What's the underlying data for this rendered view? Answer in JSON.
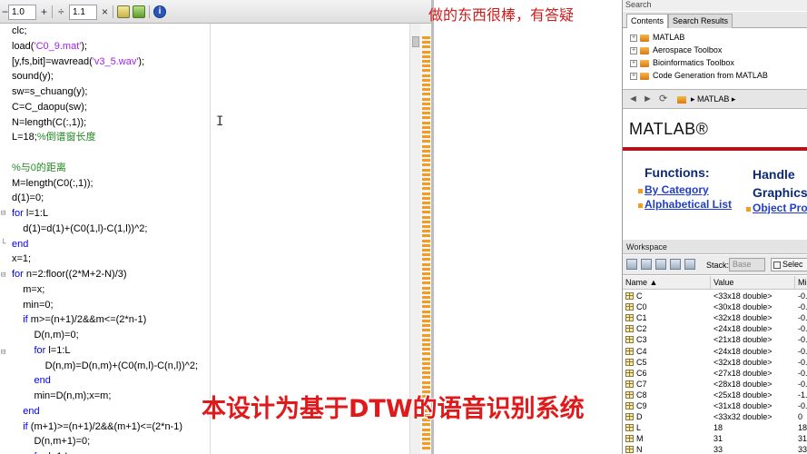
{
  "toolbar": {
    "field_left": "1.0",
    "field_right": "1.1",
    "glyph_minus": "−",
    "glyph_plus": "+",
    "glyph_divide": "÷",
    "glyph_close": "×",
    "info_glyph": "i"
  },
  "editor": {
    "lines": [
      {
        "parts": [
          {
            "t": "clc;",
            "c": "plain"
          }
        ]
      },
      {
        "parts": [
          {
            "t": "load(",
            "c": "plain"
          },
          {
            "t": "'C0_9.mat'",
            "c": "str"
          },
          {
            "t": ");",
            "c": "plain"
          }
        ]
      },
      {
        "parts": [
          {
            "t": "[y,fs,bit]=wavread(",
            "c": "plain"
          },
          {
            "t": "'v3_5.wav'",
            "c": "str"
          },
          {
            "t": ");",
            "c": "plain"
          }
        ]
      },
      {
        "parts": [
          {
            "t": "sound(y);",
            "c": "plain"
          }
        ]
      },
      {
        "parts": [
          {
            "t": "sw=s_chuang(y);",
            "c": "plain"
          }
        ]
      },
      {
        "parts": [
          {
            "t": "C=C_daopu(sw);",
            "c": "plain"
          }
        ]
      },
      {
        "parts": [
          {
            "t": "N=length(C(:,1));",
            "c": "plain"
          }
        ]
      },
      {
        "parts": [
          {
            "t": "L=18;",
            "c": "plain"
          },
          {
            "t": "%倒谱窗长度",
            "c": "cmt"
          }
        ]
      },
      {
        "parts": [
          {
            "t": "",
            "c": "plain"
          }
        ]
      },
      {
        "parts": [
          {
            "t": "%与0的距离",
            "c": "cmt"
          }
        ]
      },
      {
        "parts": [
          {
            "t": "M=length(C0(:,1));",
            "c": "plain"
          }
        ]
      },
      {
        "parts": [
          {
            "t": "d(1)=0;",
            "c": "plain"
          }
        ]
      },
      {
        "parts": [
          {
            "t": "for",
            "c": "kw"
          },
          {
            "t": " l=1:L",
            "c": "plain"
          }
        ]
      },
      {
        "parts": [
          {
            "t": "    d(1)=d(1)+(C0(1,l)-C(1,l))^2;",
            "c": "plain"
          }
        ]
      },
      {
        "parts": [
          {
            "t": "end",
            "c": "kw"
          }
        ]
      },
      {
        "parts": [
          {
            "t": "x=1;",
            "c": "plain"
          }
        ]
      },
      {
        "parts": [
          {
            "t": "for",
            "c": "kw"
          },
          {
            "t": " n=2:floor((2*M+2-N)/3)",
            "c": "plain"
          }
        ]
      },
      {
        "parts": [
          {
            "t": "    m=x;",
            "c": "plain"
          }
        ]
      },
      {
        "parts": [
          {
            "t": "    min=0;",
            "c": "plain"
          }
        ]
      },
      {
        "parts": [
          {
            "t": "    ",
            "c": "plain"
          },
          {
            "t": "if",
            "c": "kw"
          },
          {
            "t": " m>=(n+1)/2&&m<=(2*n-1)",
            "c": "plain"
          }
        ]
      },
      {
        "parts": [
          {
            "t": "        D(n,m)=0;",
            "c": "plain"
          }
        ]
      },
      {
        "parts": [
          {
            "t": "        ",
            "c": "plain"
          },
          {
            "t": "for",
            "c": "kw"
          },
          {
            "t": " l=1:L",
            "c": "plain"
          }
        ]
      },
      {
        "parts": [
          {
            "t": "            D(n,m)=D(n,m)+(C0(m,l)-C(n,l))^2;",
            "c": "plain"
          }
        ]
      },
      {
        "parts": [
          {
            "t": "        ",
            "c": "plain"
          },
          {
            "t": "end",
            "c": "kw"
          }
        ]
      },
      {
        "parts": [
          {
            "t": "        min=D(n,m);x=m;",
            "c": "plain"
          }
        ]
      },
      {
        "parts": [
          {
            "t": "    ",
            "c": "plain"
          },
          {
            "t": "end",
            "c": "kw"
          }
        ]
      },
      {
        "parts": [
          {
            "t": "    ",
            "c": "plain"
          },
          {
            "t": "if",
            "c": "kw"
          },
          {
            "t": " (m+1)>=(n+1)/2&&(m+1)<=(2*n-1)",
            "c": "plain"
          }
        ]
      },
      {
        "parts": [
          {
            "t": "        D(n,m+1)=0;",
            "c": "plain"
          }
        ]
      },
      {
        "parts": [
          {
            "t": "        ",
            "c": "plain"
          },
          {
            "t": "for",
            "c": "kw"
          },
          {
            "t": " l=1:L",
            "c": "plain"
          }
        ]
      }
    ],
    "caret_glyph": "I"
  },
  "overlay_note": "做的东西很棒，有答疑",
  "help": {
    "search_label": "Search",
    "tabs": [
      "Contents",
      "Search Results"
    ],
    "toc": [
      "MATLAB",
      "Aerospace Toolbox",
      "Bioinformatics Toolbox",
      "Code Generation from MATLAB"
    ],
    "toc_expander": "+",
    "nav_back": "◄",
    "nav_forward": "►",
    "nav_refresh": "⟳",
    "breadcrumb": "▸ MATLAB ▸",
    "logo": "MATLAB®",
    "functions_title": "Functions:",
    "functions_links": [
      "By Category",
      "Alphabetical List"
    ],
    "handle_title": "Handle Graphics",
    "handle_link": "Object Pro",
    "brand_color": "#b7131a"
  },
  "workspace": {
    "title": "Workspace",
    "stack_label": "Stack:",
    "stack_value": "Base",
    "select_label": "Selec",
    "columns": [
      "Name ▲",
      "Value",
      "Mi"
    ],
    "rows": [
      {
        "name": "C",
        "value": "<33x18 double>",
        "min": "-0."
      },
      {
        "name": "C0",
        "value": "<30x18 double>",
        "min": "-0."
      },
      {
        "name": "C1",
        "value": "<32x18 double>",
        "min": "-0."
      },
      {
        "name": "C2",
        "value": "<24x18 double>",
        "min": "-0."
      },
      {
        "name": "C3",
        "value": "<21x18 double>",
        "min": "-0."
      },
      {
        "name": "C4",
        "value": "<24x18 double>",
        "min": "-0."
      },
      {
        "name": "C5",
        "value": "<32x18 double>",
        "min": "-0."
      },
      {
        "name": "C6",
        "value": "<27x18 double>",
        "min": "-0."
      },
      {
        "name": "C7",
        "value": "<28x18 double>",
        "min": "-0."
      },
      {
        "name": "C8",
        "value": "<25x18 double>",
        "min": "-1."
      },
      {
        "name": "C9",
        "value": "<31x18 double>",
        "min": "-0."
      },
      {
        "name": "D",
        "value": "<33x32 double>",
        "min": "0"
      },
      {
        "name": "L",
        "value": "18",
        "min": "18"
      },
      {
        "name": "M",
        "value": "31",
        "min": "31"
      },
      {
        "name": "N",
        "value": "33",
        "min": "33"
      }
    ]
  },
  "caption": "本设计为基于DTW的语音识别系统"
}
